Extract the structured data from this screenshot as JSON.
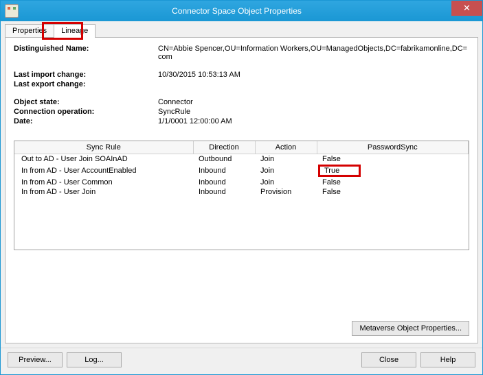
{
  "window": {
    "title": "Connector Space Object Properties",
    "close_glyph": "✕"
  },
  "tabs": {
    "properties": "Properties",
    "lineage": "Lineage"
  },
  "info": {
    "dn_label": "Distinguished Name:",
    "dn_value": "CN=Abbie Spencer,OU=Information Workers,OU=ManagedObjects,DC=fabrikamonline,DC=com",
    "last_import_label": "Last import change:",
    "last_import_value": "10/30/2015 10:53:13 AM",
    "last_export_label": "Last export change:",
    "last_export_value": "",
    "object_state_label": "Object state:",
    "object_state_value": "Connector",
    "conn_op_label": "Connection operation:",
    "conn_op_value": "SyncRule",
    "date_label": "Date:",
    "date_value": "1/1/0001 12:00:00 AM"
  },
  "table": {
    "headers": {
      "sync_rule": "Sync Rule",
      "direction": "Direction",
      "action": "Action",
      "password_sync": "PasswordSync"
    },
    "rows": [
      {
        "sync_rule": "Out to AD - User Join SOAInAD",
        "direction": "Outbound",
        "action": "Join",
        "password_sync": "False"
      },
      {
        "sync_rule": "In from AD - User AccountEnabled",
        "direction": "Inbound",
        "action": "Join",
        "password_sync": "True"
      },
      {
        "sync_rule": "In from AD - User Common",
        "direction": "Inbound",
        "action": "Join",
        "password_sync": "False"
      },
      {
        "sync_rule": "In from AD - User Join",
        "direction": "Inbound",
        "action": "Provision",
        "password_sync": "False"
      }
    ]
  },
  "buttons": {
    "metaverse": "Metaverse Object Properties...",
    "preview": "Preview...",
    "log": "Log...",
    "close": "Close",
    "help": "Help"
  }
}
